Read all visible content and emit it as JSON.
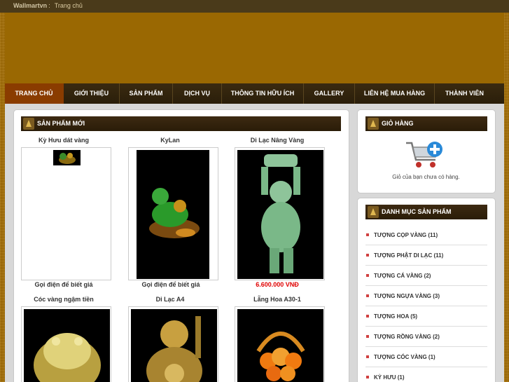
{
  "topbar": {
    "site_name": "Wallmartvn",
    "separator": ":",
    "home_link": "Trang chủ"
  },
  "nav": {
    "items": [
      {
        "label": "TRANG CHỦ",
        "active": true
      },
      {
        "label": "GIỚI THIỆU"
      },
      {
        "label": "SẢN PHẨM"
      },
      {
        "label": "DỊCH VỤ"
      },
      {
        "label": "THÔNG TIN HỮU ÍCH"
      },
      {
        "label": "GALLERY"
      },
      {
        "label": "LIÊN HỆ MUA HÀNG"
      },
      {
        "label": "THÀNH VIÊN"
      }
    ]
  },
  "new_products": {
    "title": "SẢN PHẨM MỚI",
    "products": [
      {
        "name": "Kỳ Hưu dát vàng",
        "price": "Gọi điện để biết giá"
      },
      {
        "name": "KyLan",
        "price": "Gọi điện để biết giá"
      },
      {
        "name": "Di Lạc Nâng Vàng",
        "price": "6.600.000 VNĐ"
      },
      {
        "name": "Cóc vàng ngậm tiền"
      },
      {
        "name": "Di Lạc A4"
      },
      {
        "name": "Lẵng Hoa A30-1"
      }
    ]
  },
  "cart": {
    "title": "GIỎ HÀNG",
    "empty_message": "Giỏ của bạn chưa có hàng."
  },
  "categories": {
    "title": "DANH MỤC SẢN PHẨM",
    "items": [
      "TƯỢNG CỌP VÀNG (11)",
      "TƯỢNG PHẬT DI LẠC (11)",
      "TƯỢNG CÁ VÀNG (2)",
      "TƯỢNG NGỰA VÀNG (3)",
      "TƯỢNG HOA (5)",
      "TƯỢNG RỒNG VÀNG (2)",
      "TƯỢNG CÓC VÀNG (1)",
      "KỲ HƯU (1)"
    ]
  },
  "colors": {
    "accent_red": "#e00000",
    "nav_active": "#8a3c00",
    "banner": "#9a6802"
  }
}
